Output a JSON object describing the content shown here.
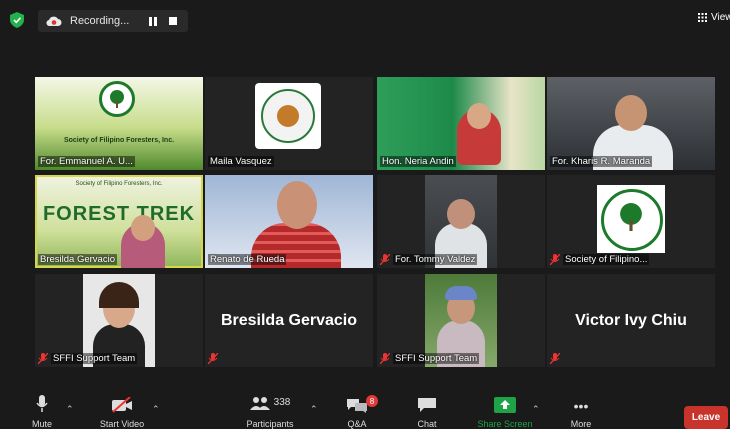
{
  "topbar": {
    "recording_label": "Recording...",
    "view_label": "View"
  },
  "tiles": [
    {
      "name": "For. Emmanuel A. U...",
      "banner": "Society of Filipino Foresters, Inc.",
      "mic_off": false
    },
    {
      "name": "Maila Vasquez",
      "mic_off": false
    },
    {
      "name": "Hon. Neria Andin",
      "mic_off": false
    },
    {
      "name": "For. Kharis R. Maranda",
      "mic_off": false
    },
    {
      "name": "Bresilda Gervacio",
      "banner_top": "Society of Filipino Foresters, Inc.",
      "banner_title": "FOREST TREK",
      "mic_off": false
    },
    {
      "name": "Renato de Rueda",
      "mic_off": false
    },
    {
      "name": "For. Tommy Valdez",
      "mic_off": true
    },
    {
      "name": "Society of Filipino...",
      "mic_off": true
    },
    {
      "name": "SFFI Support Team",
      "mic_off": true
    },
    {
      "name": "",
      "big_name": "Bresilda Gervacio",
      "mic_off": true
    },
    {
      "name": "SFFI Support Team",
      "mic_off": true
    },
    {
      "name": "",
      "big_name": "Victor Ivy Chiu",
      "mic_off": true
    }
  ],
  "toolbar": {
    "mute": "Mute",
    "start_video": "Start Video",
    "participants_count": "338",
    "participants": "Participants",
    "qa": "Q&A",
    "qa_badge": "8",
    "chat": "Chat",
    "share_screen": "Share Screen",
    "more": "More",
    "leave": "Leave"
  },
  "colors": {
    "background": "#1a1a1a",
    "accent_green": "#1fa347",
    "leave_red": "#c8332b",
    "active_speaker": "#d6d64a"
  }
}
